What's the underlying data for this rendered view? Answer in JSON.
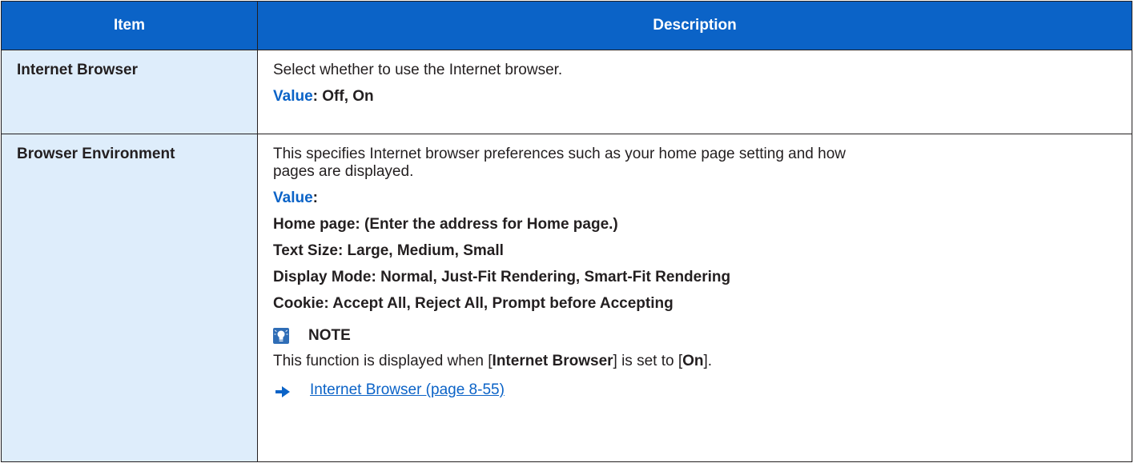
{
  "header": {
    "item": "Item",
    "description": "Description"
  },
  "rows": [
    {
      "item": "Internet Browser",
      "description": "Select whether to use the Internet browser.",
      "value_label": "Value",
      "value_text": ": Off, On"
    },
    {
      "item": "Browser Environment",
      "description_line1": "This specifies Internet browser preferences such as your home page setting and how",
      "description_line2": "pages are displayed.",
      "value_label": "Value",
      "value_colon": ":",
      "values": [
        "Home page: (Enter the address for Home page.)",
        "Text Size: Large, Medium, Small",
        "Display Mode: Normal, Just-Fit Rendering, Smart-Fit Rendering",
        "Cookie: Accept All, Reject All, Prompt before Accepting"
      ],
      "note": {
        "heading": "NOTE",
        "text_before": "This function is displayed when [",
        "term": "Internet Browser",
        "text_mid": "] is set to [",
        "setting": "On",
        "text_after": "].",
        "link": "Internet Browser (page 8-55)",
        "icon": "note-bulb-icon"
      }
    }
  ],
  "colors": {
    "header_bg": "#0b63c7",
    "item_bg": "#deedfb",
    "accent": "#0b63c7"
  }
}
